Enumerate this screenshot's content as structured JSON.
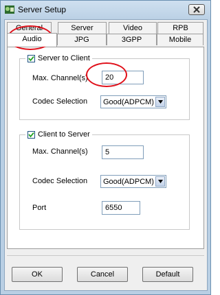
{
  "window": {
    "title": "Server Setup"
  },
  "tabs": {
    "row1": [
      "General",
      "Server",
      "Video",
      "RPB"
    ],
    "row2": [
      "Audio",
      "JPG",
      "3GPP",
      "Mobile"
    ],
    "active": "Audio"
  },
  "server_to_client": {
    "label": "Server to Client",
    "checked": true,
    "max_channels_label": "Max. Channel(s)",
    "max_channels_value": "20",
    "codec_label": "Codec Selection",
    "codec_value": "Good(ADPCM)"
  },
  "client_to_server": {
    "label": "Client to Server",
    "checked": true,
    "max_channels_label": "Max. Channel(s)",
    "max_channels_value": "5",
    "codec_label": "Codec Selection",
    "codec_value": "Good(ADPCM)",
    "port_label": "Port",
    "port_value": "6550"
  },
  "buttons": {
    "ok": "OK",
    "cancel": "Cancel",
    "default": "Default"
  },
  "annotation_color": "#e0101a"
}
